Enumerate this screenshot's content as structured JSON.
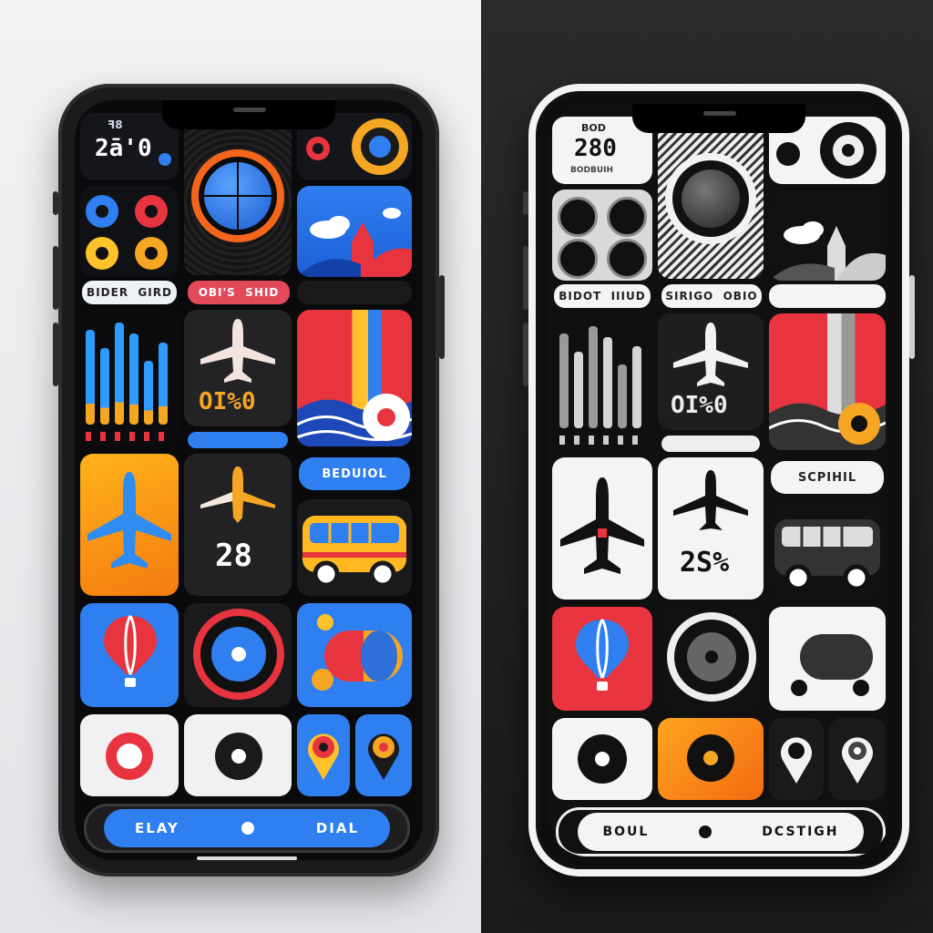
{
  "left_phone": {
    "status_number": "2ā'0",
    "status_mini": "ꟻ8",
    "pill_1": "BIDER ⁠ GIRD",
    "pill_2": "OBI'S ⁠ SHID",
    "flight_percent": "OI%0",
    "stat_small_pill": "",
    "button_label": "BEDUIOL",
    "temp_value": "28",
    "dock_left": "ELAY",
    "dock_right": "DIAL"
  },
  "right_phone": {
    "status_number": "280",
    "status_top": "BOD",
    "status_sub": "BODBUIH",
    "pill_1": "BIDOT ⁠ IIIUD",
    "pill_2": "SIRIGO ⁠ OBIO",
    "flight_percent": "OI%0",
    "button_label": "SCPIHIL",
    "temp_value": "2S%",
    "dock_left": "BOUL",
    "dock_right": "DCSTIGH"
  },
  "colors": {
    "blue": "#2f7ff0",
    "orange": "#f5a623",
    "red": "#e8343f",
    "yellow": "#ffc22a",
    "left_bg": "#eeeef0",
    "right_bg": "#222224"
  },
  "icons": [
    "airplane-icon",
    "bus-icon",
    "balloon-icon",
    "dial-icon",
    "location-pin-icon",
    "cloud-icon"
  ]
}
